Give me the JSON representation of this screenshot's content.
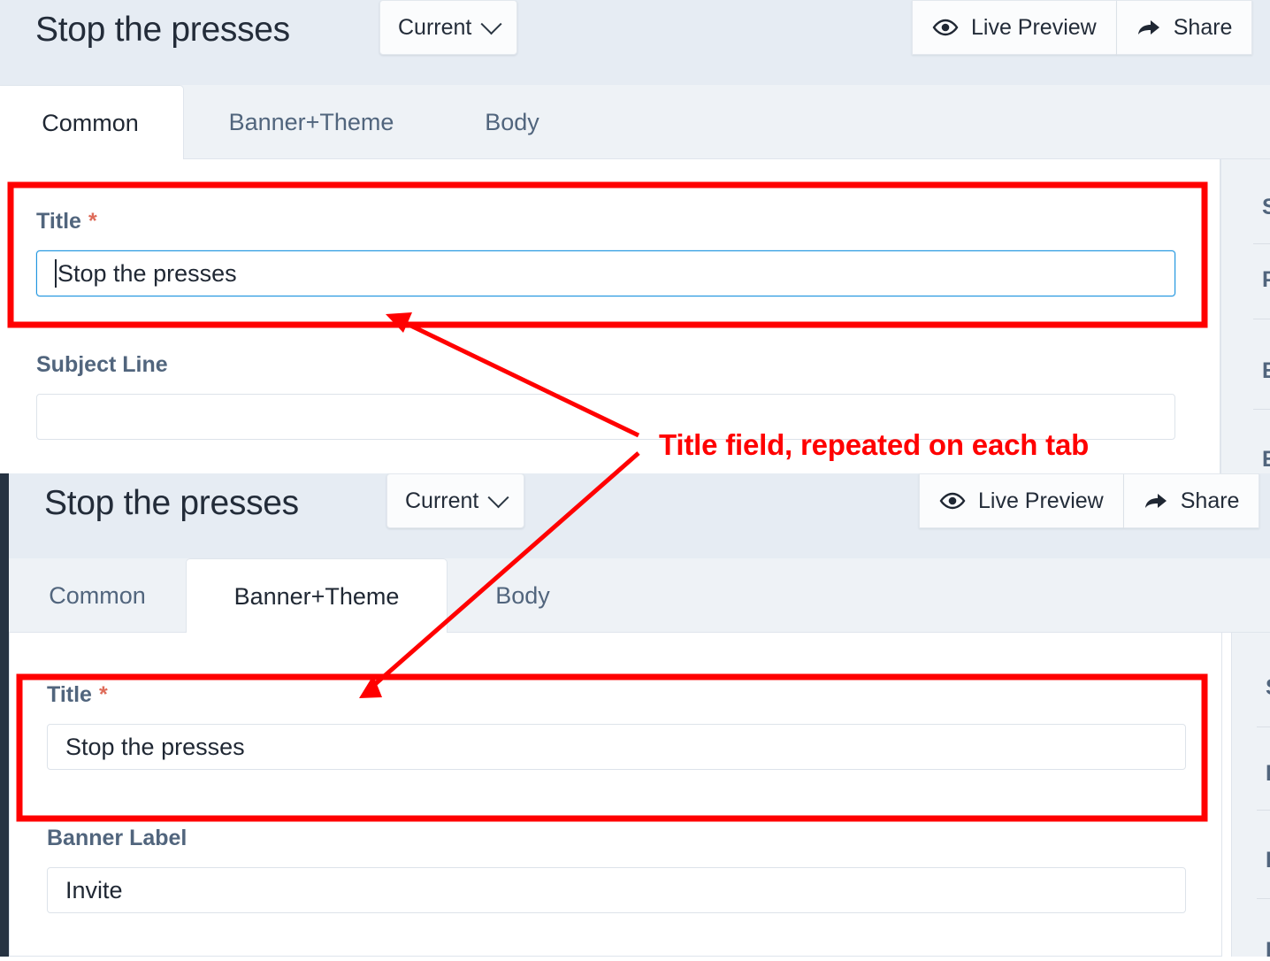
{
  "annotation": {
    "color": "#ff0000",
    "note": "Title field, repeated on each tab"
  },
  "panels": [
    {
      "id": "panel-common",
      "header": {
        "title": "Stop the presses",
        "version_select": {
          "value": "Current",
          "icon": "chevron-down-icon"
        },
        "actions": [
          {
            "label": "Live Preview",
            "icon": "eye-icon"
          },
          {
            "label": "Share",
            "icon": "share-arrow-icon"
          }
        ]
      },
      "tabs": [
        {
          "label": "Common",
          "active": true
        },
        {
          "label": "Banner+Theme",
          "active": false
        },
        {
          "label": "Body",
          "active": false
        }
      ],
      "fields": [
        {
          "label": "Title",
          "required": true,
          "value": "Stop the presses",
          "placeholder": "",
          "focused": true,
          "highlighted": true
        },
        {
          "label": "Subject Line",
          "required": false,
          "value": "",
          "placeholder": "",
          "focused": false,
          "highlighted": false
        }
      ],
      "right_rail": [
        "S",
        "P",
        "E",
        "E"
      ]
    },
    {
      "id": "panel-banner-theme",
      "header": {
        "title": "Stop the presses",
        "version_select": {
          "value": "Current",
          "icon": "chevron-down-icon"
        },
        "actions": [
          {
            "label": "Live Preview",
            "icon": "eye-icon"
          },
          {
            "label": "Share",
            "icon": "share-arrow-icon"
          }
        ]
      },
      "tabs": [
        {
          "label": "Common",
          "active": false
        },
        {
          "label": "Banner+Theme",
          "active": true
        },
        {
          "label": "Body",
          "active": false
        }
      ],
      "fields": [
        {
          "label": "Title",
          "required": true,
          "value": "Stop the presses",
          "placeholder": "",
          "focused": false,
          "highlighted": true
        },
        {
          "label": "Banner Label",
          "required": false,
          "value": "Invite",
          "placeholder": "",
          "focused": false,
          "highlighted": false
        }
      ],
      "right_rail": [
        "S",
        "P",
        "E",
        "E"
      ]
    }
  ],
  "colors": {
    "header_bg": "#e6ecf3",
    "tabbar_bg": "#eef2f6",
    "label": "#51657d",
    "focus_border": "#2196e0",
    "required_star": "#de6b59",
    "annotation": "#ff0000"
  }
}
